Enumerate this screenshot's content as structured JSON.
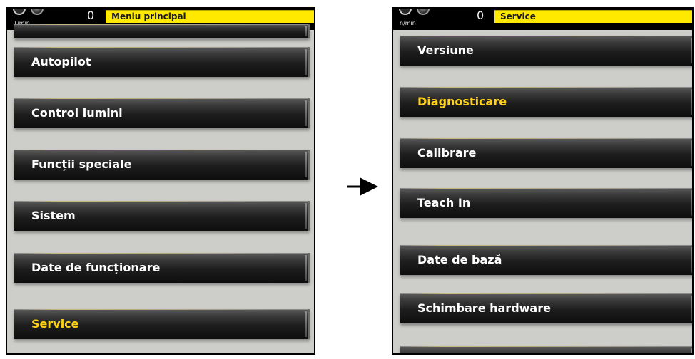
{
  "left_screen": {
    "unit": "1/min",
    "counter": "0",
    "title": "Meniu principal",
    "items": [
      {
        "label": "Autopilot",
        "active": false
      },
      {
        "label": "Control lumini",
        "active": false
      },
      {
        "label": "Funcții speciale",
        "active": false
      },
      {
        "label": "Sistem",
        "active": false
      },
      {
        "label": "Date de funcționare",
        "active": false
      },
      {
        "label": "Service",
        "active": true
      }
    ]
  },
  "right_screen": {
    "unit": "n/min",
    "counter": "0",
    "title": "Service",
    "items": [
      {
        "label": "Versiune",
        "active": false
      },
      {
        "label": "Diagnosticare",
        "active": true
      },
      {
        "label": "Calibrare",
        "active": false
      },
      {
        "label": "Teach In",
        "active": false
      },
      {
        "label": "Date de bază",
        "active": false
      },
      {
        "label": "Schimbare hardware",
        "active": false
      },
      {
        "label": "",
        "active": false
      }
    ]
  },
  "colors": {
    "title_bar": "#ffe900",
    "active_label": "#ffd21a",
    "label": "#ffffff"
  },
  "icons": {
    "arrow": "arrow-right-icon",
    "gauge": "gauge-icon"
  }
}
